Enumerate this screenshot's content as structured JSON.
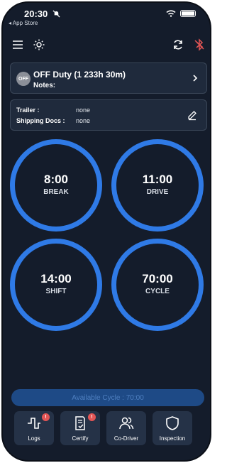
{
  "status_bar": {
    "time": "20:30",
    "back_label": "◂ App Store"
  },
  "duty": {
    "badge": "OFF",
    "title": "OFF Duty (1 233h 30m)",
    "notes_label": "Notes:"
  },
  "trailer": {
    "trailer_label": "Trailer :",
    "trailer_value": "none",
    "docs_label": "Shipping Docs :",
    "docs_value": "none"
  },
  "timers": [
    {
      "value": "8:00",
      "label": "BREAK"
    },
    {
      "value": "11:00",
      "label": "DRIVE"
    },
    {
      "value": "14:00",
      "label": "SHIFT"
    },
    {
      "value": "70:00",
      "label": "CYCLE"
    }
  ],
  "available_cycle": "Available Cycle : 70:00",
  "bottom_nav": [
    {
      "label": "Logs",
      "icon": "logs-icon",
      "badge": "!"
    },
    {
      "label": "Certify",
      "icon": "certify-icon",
      "badge": "!"
    },
    {
      "label": "Co-Driver",
      "icon": "co-driver-icon"
    },
    {
      "label": "Inspection",
      "icon": "inspection-icon"
    }
  ],
  "colors": {
    "background": "#141c2b",
    "card": "#1f2a3c",
    "ring": "#2f7ae6",
    "cycle_bar": "#1e4a86",
    "badge": "#e25555"
  }
}
